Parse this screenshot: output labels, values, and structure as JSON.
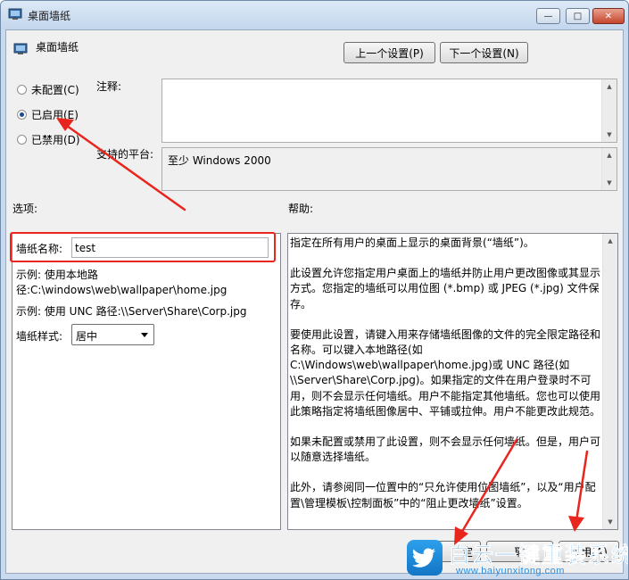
{
  "window": {
    "title": "桌面墙纸",
    "controls": {
      "minimize": "—",
      "maximize": "□",
      "close": "✕"
    }
  },
  "header": {
    "title": "桌面墙纸",
    "prev_setting": "上一个设置(P)",
    "next_setting": "下一个设置(N)"
  },
  "state": {
    "options": [
      {
        "label": "未配置(C)",
        "selected": false
      },
      {
        "label": "已启用(E)",
        "selected": true
      },
      {
        "label": "已禁用(D)",
        "selected": false
      }
    ]
  },
  "comment": {
    "label": "注释:",
    "value": ""
  },
  "platform": {
    "label": "支持的平台:",
    "value": "至少 Windows 2000"
  },
  "options_section": {
    "label": "选项:",
    "wallpaper_name_label": "墙纸名称:",
    "wallpaper_name_value": "test",
    "example_local_1": "示例: 使用本地路",
    "example_local_2": "径:C:\\windows\\web\\wallpaper\\home.jpg",
    "example_unc": "示例: 使用 UNC 路径:\\\\Server\\Share\\Corp.jpg",
    "style_label": "墙纸样式:",
    "style_value": "居中"
  },
  "help_section": {
    "label": "帮助:",
    "paragraphs": [
      "指定在所有用户的桌面上显示的桌面背景(“墙纸”)。",
      "此设置允许您指定用户桌面上的墙纸并防止用户更改图像或其显示方式。您指定的墙纸可以用位图 (*.bmp) 或 JPEG (*.jpg) 文件保存。",
      "要使用此设置，请键入用来存储墙纸图像的文件的完全限定路径和名称。可以键入本地路径(如 C:\\Windows\\web\\wallpaper\\home.jpg)或 UNC 路径(如 \\\\Server\\Share\\Corp.jpg)。如果指定的文件在用户登录时不可用，则不会显示任何墙纸。用户不能指定其他墙纸。您也可以使用此策略指定将墙纸图像居中、平铺或拉伸。用户不能更改此规范。",
      "如果未配置或禁用了此设置，则不会显示任何墙纸。但是，用户可以随意选择墙纸。",
      "此外，请参阅同一位置中的“只允许使用位图墙纸”，以及“用户配置\\管理模板\\控制面板”中的“阻止更改墙纸”设置。"
    ]
  },
  "footer": {
    "ok_partial": "定",
    "cancel_partial": "取",
    "apply_partial": "应用(A)"
  },
  "watermark": {
    "main_text": "白云一键重装系统",
    "url": "www.baiyunxitong.com"
  },
  "colors": {
    "annotation_red": "#e8261e",
    "watermark_blue": "#2c8ee0"
  },
  "icons": [
    "policy-icon",
    "minimize-icon",
    "maximize-icon",
    "close-icon",
    "scroll-up-icon",
    "scroll-down-icon",
    "dropdown-caret-icon",
    "twitter-bird-icon"
  ]
}
